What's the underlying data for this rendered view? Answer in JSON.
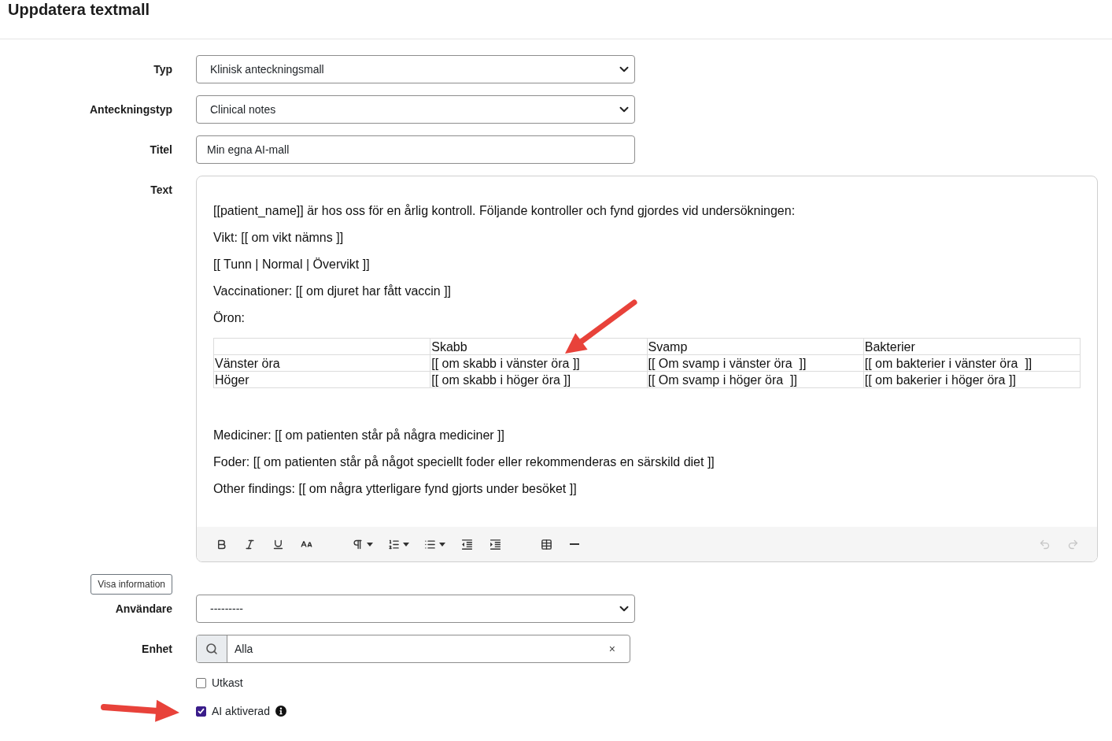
{
  "header": {
    "title": "Uppdatera textmall"
  },
  "fields": [
    {
      "kind": "select",
      "label": "Typ",
      "value": "Klinisk anteckningsmall"
    },
    {
      "kind": "select",
      "label": "Anteckningstyp",
      "value": "Clinical notes"
    },
    {
      "kind": "text",
      "label": "Titel",
      "value": "Min egna AI-mall"
    },
    {
      "kind": "editor",
      "label": "Text",
      "content": [
        {
          "kind": "paragraph",
          "text": "[[patient_name]] är hos oss för en årlig kontroll. Följande kontroller och fynd gjordes vid undersökningen:"
        },
        {
          "kind": "paragraph",
          "text": "Vikt: [[ om vikt nämns ]]"
        },
        {
          "kind": "paragraph",
          "text": "[[ Tunn | Normal | Övervikt ]]"
        },
        {
          "kind": "paragraph",
          "text": "Vaccinationer: [[ om djuret har fått vaccin ]]"
        },
        {
          "kind": "paragraph",
          "text": "Öron:"
        },
        {
          "kind": "table",
          "marked_by_arrow": true,
          "columns": [
            "Skabb",
            "Svamp",
            "Bakterier"
          ],
          "rows": [
            {
              "label": "Vänster öra",
              "cells": [
                "[[ om skabb i vänster öra ]]",
                "[[ Om svamp i vänster öra  ]]",
                "[[ om bakterier i vänster öra  ]]"
              ]
            },
            {
              "label": "Höger",
              "cells": [
                "[[ om skabb i höger öra ]]",
                "[[ Om svamp i höger öra  ]]",
                "[[ om bakerier i höger öra ]]"
              ]
            }
          ]
        },
        {
          "kind": "paragraph",
          "text": "Mediciner: [[ om patienten står på några mediciner ]]"
        },
        {
          "kind": "paragraph",
          "text": "Foder: [[ om patienten står på något speciellt foder eller rekommenderas en särskild diet ]]"
        },
        {
          "kind": "paragraph",
          "text": "Other findings: [[ om några ytterligare fynd gjorts under besöket ]]"
        }
      ],
      "toolbar": [
        {
          "kind": "bold",
          "dropdown": false,
          "disabled": false
        },
        {
          "kind": "italic",
          "dropdown": false,
          "disabled": false
        },
        {
          "kind": "underline",
          "dropdown": false,
          "disabled": false
        },
        {
          "kind": "font_size",
          "dropdown": false,
          "disabled": false
        },
        {
          "kind": "paragraph_format",
          "dropdown": true,
          "disabled": false
        },
        {
          "kind": "ordered_list",
          "dropdown": true,
          "disabled": false
        },
        {
          "kind": "unordered_list",
          "dropdown": true,
          "disabled": false
        },
        {
          "kind": "outdent",
          "dropdown": false,
          "disabled": false
        },
        {
          "kind": "indent",
          "dropdown": false,
          "disabled": false
        },
        {
          "kind": "table",
          "dropdown": false,
          "disabled": false
        },
        {
          "kind": "horizontal_rule",
          "dropdown": false,
          "disabled": false
        },
        {
          "kind": "undo",
          "dropdown": false,
          "disabled": true
        },
        {
          "kind": "redo",
          "dropdown": false,
          "disabled": true
        }
      ]
    },
    {
      "kind": "button",
      "label": "Visa information"
    },
    {
      "kind": "select",
      "label": "Användare",
      "value": "---------"
    },
    {
      "kind": "search_select",
      "label": "Enhet",
      "value": "Alla",
      "clear": "×"
    },
    {
      "kind": "checkbox",
      "label": "Utkast",
      "checked": false,
      "info": false,
      "marked_by_arrow": false
    },
    {
      "kind": "checkbox",
      "label": "AI aktiverad",
      "checked": true,
      "info": true,
      "marked_by_arrow": true
    }
  ]
}
